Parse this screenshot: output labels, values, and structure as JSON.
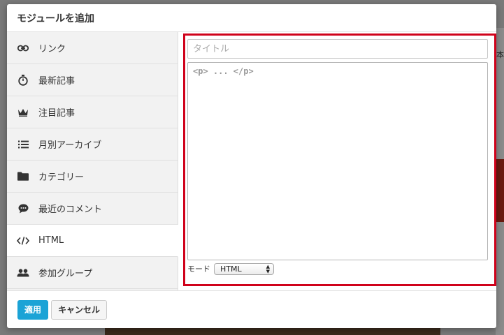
{
  "background": {
    "edge_text": "本"
  },
  "modal": {
    "title": "モジュールを追加",
    "sidebar": {
      "items": [
        {
          "label": "リンク",
          "icon": "link-icon",
          "active": false
        },
        {
          "label": "最新記事",
          "icon": "stopwatch-icon",
          "active": false
        },
        {
          "label": "注目記事",
          "icon": "crown-icon",
          "active": false
        },
        {
          "label": "月別アーカイブ",
          "icon": "list-icon",
          "active": false
        },
        {
          "label": "カテゴリー",
          "icon": "folder-icon",
          "active": false
        },
        {
          "label": "最近のコメント",
          "icon": "comment-icon",
          "active": false
        },
        {
          "label": "HTML",
          "icon": "code-icon",
          "active": true
        },
        {
          "label": "参加グループ",
          "icon": "users-icon",
          "active": false
        }
      ]
    },
    "editor": {
      "title_placeholder": "タイトル",
      "body_placeholder": "<p> ... </p>",
      "mode_label": "モード",
      "mode_value": "HTML"
    },
    "footer": {
      "apply_label": "適用",
      "cancel_label": "キャンセル"
    },
    "colors": {
      "highlight": "#d0021b",
      "apply": "#1ba3d6"
    }
  }
}
